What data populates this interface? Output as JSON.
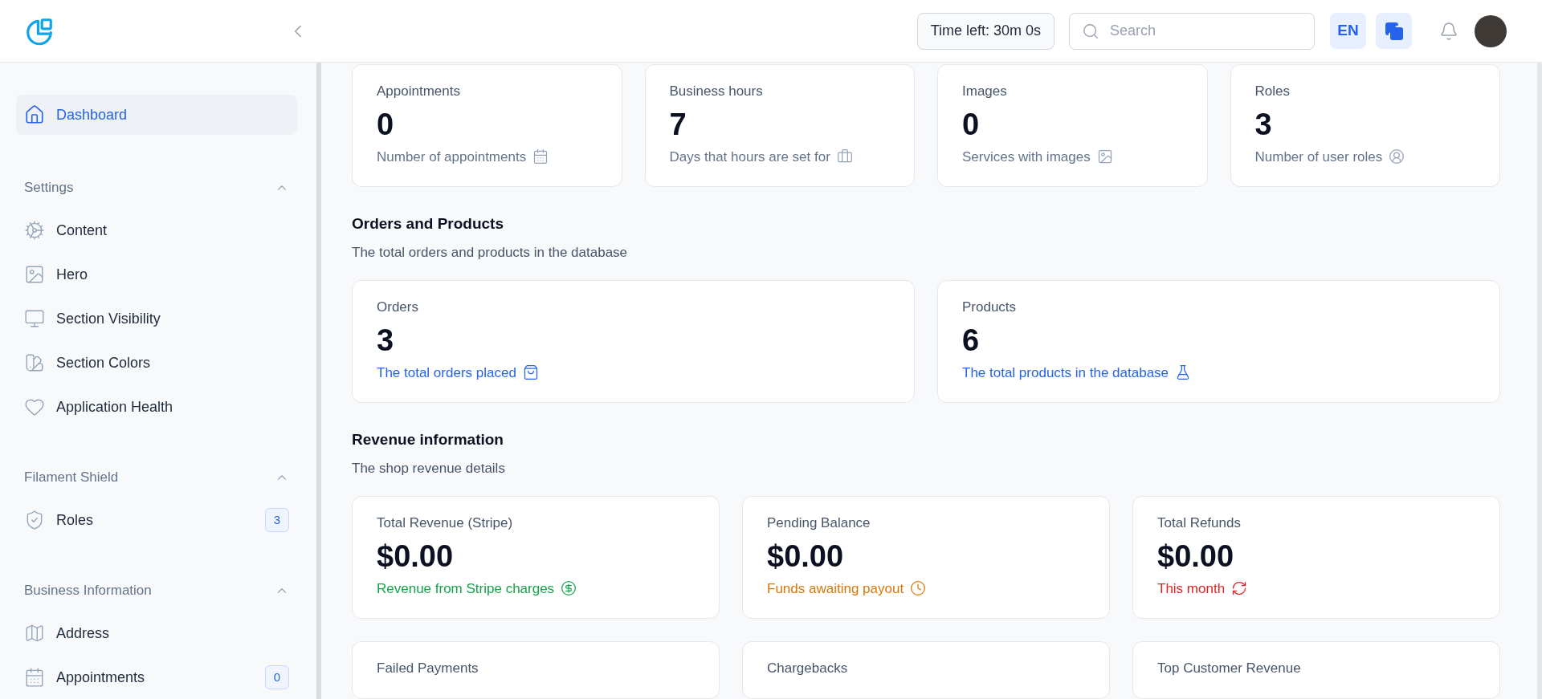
{
  "header": {
    "timer": "Time left: 30m 0s",
    "search": {
      "placeholder": "Search"
    },
    "language": "EN"
  },
  "sidebar": {
    "top_item": {
      "label": "Dashboard",
      "selected": true
    },
    "groups": [
      {
        "label": "Settings",
        "expanded": true,
        "items": [
          {
            "label": "Content",
            "selected": false
          },
          {
            "label": "Hero",
            "selected": false
          },
          {
            "label": "Section Visibility",
            "selected": false
          },
          {
            "label": "Section Colors",
            "selected": false
          },
          {
            "label": "Application Health",
            "selected": false
          }
        ]
      },
      {
        "label": "Filament Shield",
        "expanded": true,
        "items": [
          {
            "label": "Roles",
            "badge": "3",
            "selected": false
          }
        ]
      },
      {
        "label": "Business Information",
        "expanded": true,
        "items": [
          {
            "label": "Address",
            "selected": false
          },
          {
            "label": "Appointments",
            "badge": "0",
            "selected": false
          }
        ]
      }
    ]
  },
  "overview_stats": [
    {
      "label": "Appointments",
      "value": "0",
      "description": "Number of appointments"
    },
    {
      "label": "Business hours",
      "value": "7",
      "description": "Days that hours are set for"
    },
    {
      "label": "Images",
      "value": "0",
      "description": "Services with images"
    },
    {
      "label": "Roles",
      "value": "3",
      "description": "Number of user roles"
    }
  ],
  "sections": [
    {
      "title": "Orders and Products",
      "subtitle": "The total orders and products in the database",
      "stats": [
        {
          "label": "Orders",
          "value": "3",
          "description": "The total orders placed",
          "color": "#2563eb"
        },
        {
          "label": "Products",
          "value": "6",
          "description": "The total products in the database",
          "color": "#2563eb"
        }
      ]
    },
    {
      "title": "Revenue information",
      "subtitle": "The shop revenue details",
      "stats": [
        {
          "label": "Total Revenue (Stripe)",
          "value": "$0.00",
          "description": "Revenue from Stripe charges",
          "color": "#16a34a"
        },
        {
          "label": "Pending Balance",
          "value": "$0.00",
          "description": "Funds awaiting payout",
          "color": "#d97706"
        },
        {
          "label": "Total Refunds",
          "value": "$0.00",
          "description": "This month",
          "color": "#dc2626"
        },
        {
          "label": "Failed Payments"
        },
        {
          "label": "Chargebacks"
        },
        {
          "label": "Top Customer Revenue"
        }
      ]
    }
  ]
}
